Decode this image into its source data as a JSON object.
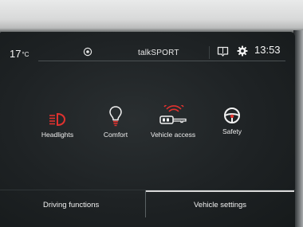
{
  "status": {
    "temperature": "17",
    "temperature_unit": "°C",
    "source": "talkSPORT",
    "time": "13:53"
  },
  "tiles": [
    {
      "label": "Headlights",
      "icon": "headlight-icon"
    },
    {
      "label": "Comfort",
      "icon": "lightbulb-icon"
    },
    {
      "label": "Vehicle access",
      "icon": "key-fob-icon"
    },
    {
      "label": "Safety",
      "icon": "steering-wheel-icon"
    }
  ],
  "bottom_tabs": [
    {
      "label": "Driving functions",
      "active": false
    },
    {
      "label": "Vehicle settings",
      "active": true
    }
  ],
  "colors": {
    "accent_red": "#e0322f",
    "text": "#f2f2f2",
    "screen": "#1e2224"
  }
}
